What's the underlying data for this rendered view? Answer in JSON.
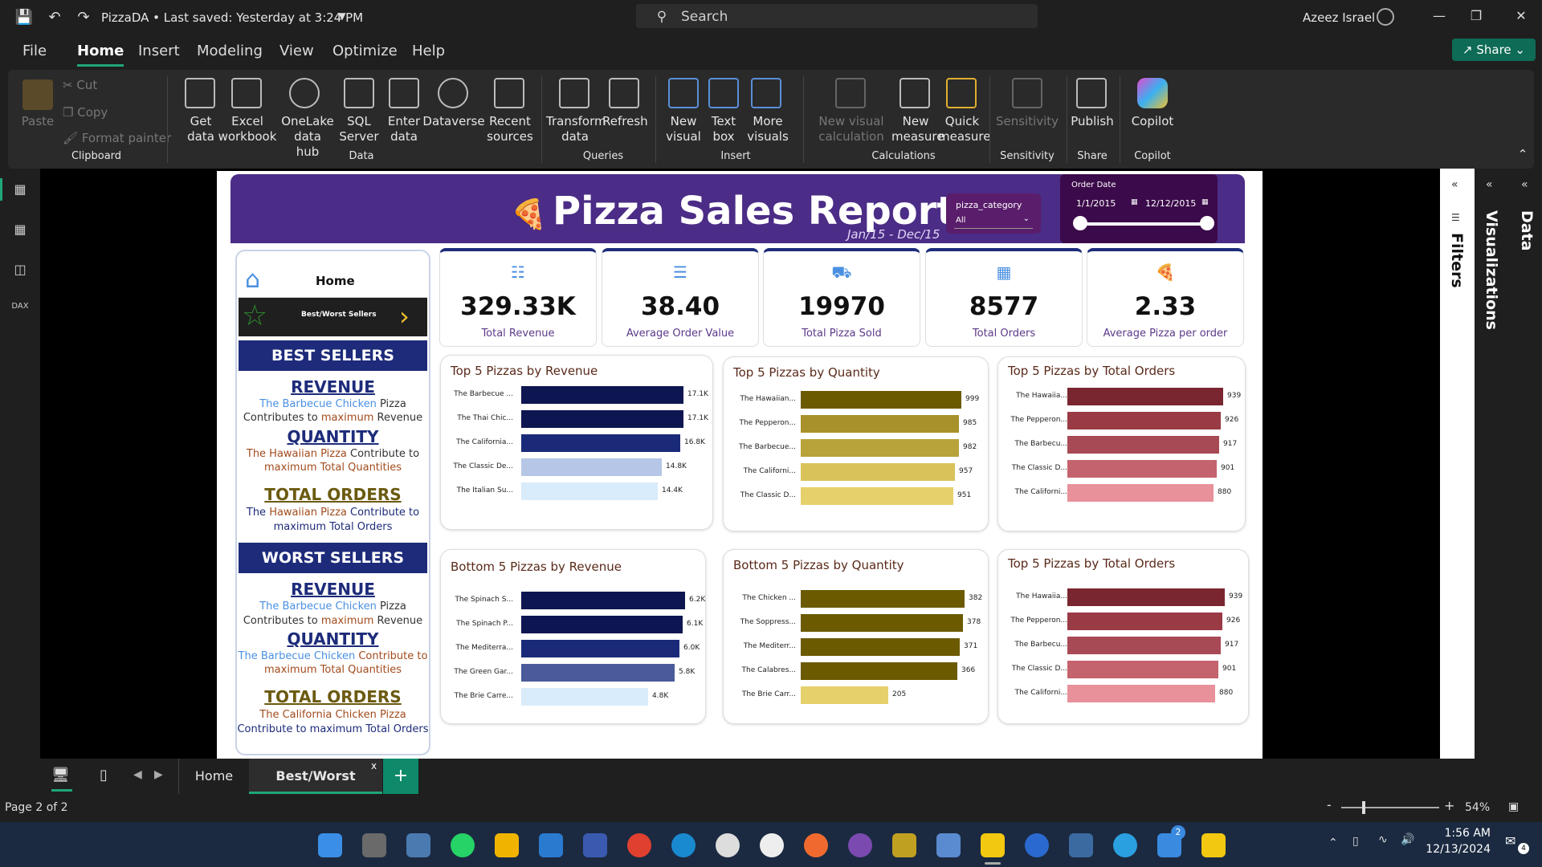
{
  "titlebar": {
    "title": "PizzaDA • Last saved: Yesterday at 3:24 PM",
    "search_placeholder": "Search",
    "user": "Azeez Israel"
  },
  "menu": {
    "items": [
      "File",
      "Home",
      "Insert",
      "Modeling",
      "View",
      "Optimize",
      "Help"
    ],
    "active": "Home",
    "share": "Share"
  },
  "ribbon": {
    "clipboard": {
      "paste": "Paste",
      "cut": "Cut",
      "copy": "Copy",
      "format_painter": "Format painter",
      "group": "Clipboard"
    },
    "data": {
      "get_data": "Get data",
      "excel": "Excel workbook",
      "onelake": "OneLake data hub",
      "sql": "SQL Server",
      "enter": "Enter data",
      "dataverse": "Dataverse",
      "recent": "Recent sources",
      "group": "Data"
    },
    "queries": {
      "transform": "Transform data",
      "refresh": "Refresh",
      "group": "Queries"
    },
    "insert": {
      "new_visual": "New visual",
      "text_box": "Text box",
      "more_visuals": "More visuals",
      "group": "Insert"
    },
    "calculations": {
      "new_visual_calc": "New visual calculation",
      "new_measure": "New measure",
      "quick_measure": "Quick measure",
      "group": "Calculations"
    },
    "sensitivity": {
      "label": "Sensitivity",
      "group": "Sensitivity"
    },
    "share": {
      "publish": "Publish",
      "group": "Share"
    },
    "copilot": {
      "label": "Copilot",
      "group": "Copilot"
    }
  },
  "report": {
    "title": "Pizza Sales Report",
    "subtitle": "Jan/15 - Dec/15",
    "slicer_category": {
      "title": "pizza_category",
      "value": "All"
    },
    "slicer_date": {
      "title": "Order Date",
      "from": "1/1/2015",
      "to": "12/12/2015"
    },
    "kpis": [
      {
        "value": "329.33K",
        "label": "Total Revenue",
        "icon": "revenue-icon"
      },
      {
        "value": "38.40",
        "label": "Average Order Value",
        "icon": "clipboard-icon"
      },
      {
        "value": "19970",
        "label": "Total Pizza Sold",
        "icon": "delivery-icon"
      },
      {
        "value": "8577",
        "label": "Total Orders",
        "icon": "orders-icon"
      },
      {
        "value": "2.33",
        "label": "Average Pizza per order",
        "icon": "pizza-slice-icon"
      }
    ],
    "nav": {
      "home": "Home",
      "best_worst": "Best/Worst Sellers",
      "best_sellers": "BEST SELLERS",
      "worst_sellers": "WORST SELLERS",
      "revenue": "REVENUE",
      "quantity": "QUANTITY",
      "total_orders": "TOTAL ORDERS",
      "best": {
        "rev_name": "The Barbecue Chicken",
        "rev_l1_tail": " Pizza",
        "rev_l2a": "Contributes to ",
        "rev_l2b": "maximum",
        "rev_l2c": " Revenue",
        "qty_name": "The Hawaiian Pizza",
        "qty_l1_tail": " Contribute to",
        "qty_l2": "maximum Total Quantities",
        "ord_l1a": "The ",
        "ord_name": "Hawaiian  Pizza",
        "ord_l1_tail": " Contribute to",
        "ord_l2": "maximum Total Orders"
      },
      "worst": {
        "rev_name": "The Barbecue Chicken",
        "rev_l1_tail": " Pizza",
        "rev_l2a": "Contributes to ",
        "rev_l2b": "maximum",
        "rev_l2c": " Revenue",
        "qty_name": "The Barbecue Chicken",
        "qty_l1_tail": " Contribute to",
        "qty_l2": "maximum Total Quantities",
        "ord_name": "The California Chicken Pizza",
        "ord_l2": "Contribute to maximum Total Orders"
      }
    }
  },
  "chart_data": [
    {
      "type": "bar",
      "title": "Top 5 Pizzas by Revenue",
      "categories": [
        "The Barbecue ...",
        "The Thai Chic...",
        "The California...",
        "The Classic De...",
        "The Italian Su..."
      ],
      "values": [
        17.1,
        17.1,
        16.8,
        14.8,
        14.4
      ],
      "value_labels": [
        "17.1K",
        "17.1K",
        "16.8K",
        "14.8K",
        "14.4K"
      ],
      "colors": [
        "#0d1650",
        "#0d1650",
        "#1b2a78",
        "#b5c6e6",
        "#d9ecfb"
      ]
    },
    {
      "type": "bar",
      "title": "Top 5 Pizzas by Quantity",
      "categories": [
        "The Hawaiian...",
        "The Pepperon...",
        "The Barbecue...",
        "The Californi...",
        "The Classic D..."
      ],
      "values": [
        999,
        985,
        982,
        957,
        951
      ],
      "value_labels": [
        "999",
        "985",
        "982",
        "957",
        "951"
      ],
      "colors": [
        "#6b5a00",
        "#a8912a",
        "#b8a23a",
        "#d9c25a",
        "#e6d06c"
      ]
    },
    {
      "type": "bar",
      "title": "Top 5 Pizzas by Total Orders",
      "categories": [
        "The Hawaiia...",
        "The Pepperon...",
        "The Barbecu...",
        "The Classic D...",
        "The Californi..."
      ],
      "values": [
        939,
        926,
        917,
        901,
        880
      ],
      "value_labels": [
        "939",
        "926",
        "917",
        "901",
        "880"
      ],
      "colors": [
        "#7a2630",
        "#9a3a45",
        "#a84a55",
        "#c4626d",
        "#e8919a"
      ]
    },
    {
      "type": "bar",
      "title": "Bottom 5 Pizzas by Revenue",
      "categories": [
        "The Spinach S...",
        "The Spinach P...",
        "The Mediterra...",
        "The Green Gar...",
        "The Brie Carre..."
      ],
      "values": [
        6.2,
        6.1,
        6.0,
        5.8,
        4.8
      ],
      "value_labels": [
        "6.2K",
        "6.1K",
        "6.0K",
        "5.8K",
        "4.8K"
      ],
      "colors": [
        "#0d1650",
        "#0d1650",
        "#1b2a78",
        "#4a5a9a",
        "#d9ecfb"
      ]
    },
    {
      "type": "bar",
      "title": "Bottom 5 Pizzas by Quantity",
      "categories": [
        "The Chicken ...",
        "The Soppress...",
        "The Mediterr...",
        "The Calabres...",
        "The Brie Carr..."
      ],
      "values": [
        382,
        378,
        371,
        366,
        205
      ],
      "value_labels": [
        "382",
        "378",
        "371",
        "366",
        "205"
      ],
      "colors": [
        "#6b5a00",
        "#6b5a00",
        "#6b5a00",
        "#6b5a00",
        "#e6d06c"
      ]
    },
    {
      "type": "bar",
      "title": "Top 5 Pizzas by Total Orders",
      "categories": [
        "The Hawaiia...",
        "The Pepperon...",
        "The Barbecu...",
        "The Classic D...",
        "The Californi..."
      ],
      "values": [
        939,
        926,
        917,
        901,
        880
      ],
      "value_labels": [
        "939",
        "926",
        "917",
        "901",
        "880"
      ],
      "colors": [
        "#7a2630",
        "#9a3a45",
        "#a84a55",
        "#c4626d",
        "#e8919a"
      ]
    }
  ],
  "right_panes": {
    "filters": "Filters",
    "visualizations": "Visualizations",
    "data": "Data"
  },
  "pages": {
    "tabs": [
      "Home",
      "Best/Worst Sellers"
    ],
    "active": "Best/Worst Sellers",
    "page_indicator": "Page 2 of 2",
    "zoom": "54%"
  },
  "taskbar": {
    "time": "1:56 AM",
    "date": "12/13/2024",
    "badge_count": "2",
    "notif_count": "4"
  }
}
